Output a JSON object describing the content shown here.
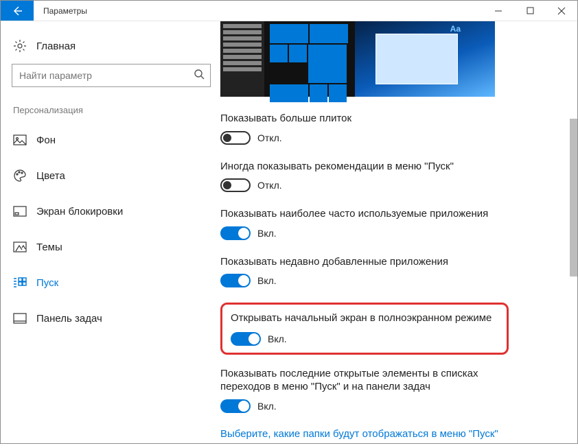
{
  "titlebar": {
    "title": "Параметры"
  },
  "sidebar": {
    "home": "Главная",
    "search_placeholder": "Найти параметр",
    "category": "Персонализация",
    "items": [
      {
        "label": "Фон"
      },
      {
        "label": "Цвета"
      },
      {
        "label": "Экран блокировки"
      },
      {
        "label": "Темы"
      },
      {
        "label": "Пуск"
      },
      {
        "label": "Панель задач"
      }
    ]
  },
  "content": {
    "on_label": "Вкл.",
    "off_label": "Откл.",
    "settings": [
      {
        "label": "Показывать больше плиток",
        "state": "off"
      },
      {
        "label": "Иногда показывать рекомендации в меню \"Пуск\"",
        "state": "off"
      },
      {
        "label": "Показывать наиболее часто используемые приложения",
        "state": "on"
      },
      {
        "label": "Показывать недавно добавленные приложения",
        "state": "on"
      },
      {
        "label": "Открывать начальный экран в полноэкранном режиме",
        "state": "on",
        "highlighted": true
      },
      {
        "label": "Показывать последние открытые элементы в списках переходов в меню \"Пуск\" и на панели задач",
        "state": "on"
      }
    ],
    "folders_link": "Выберите, какие папки будут отображаться в меню \"Пуск\""
  }
}
